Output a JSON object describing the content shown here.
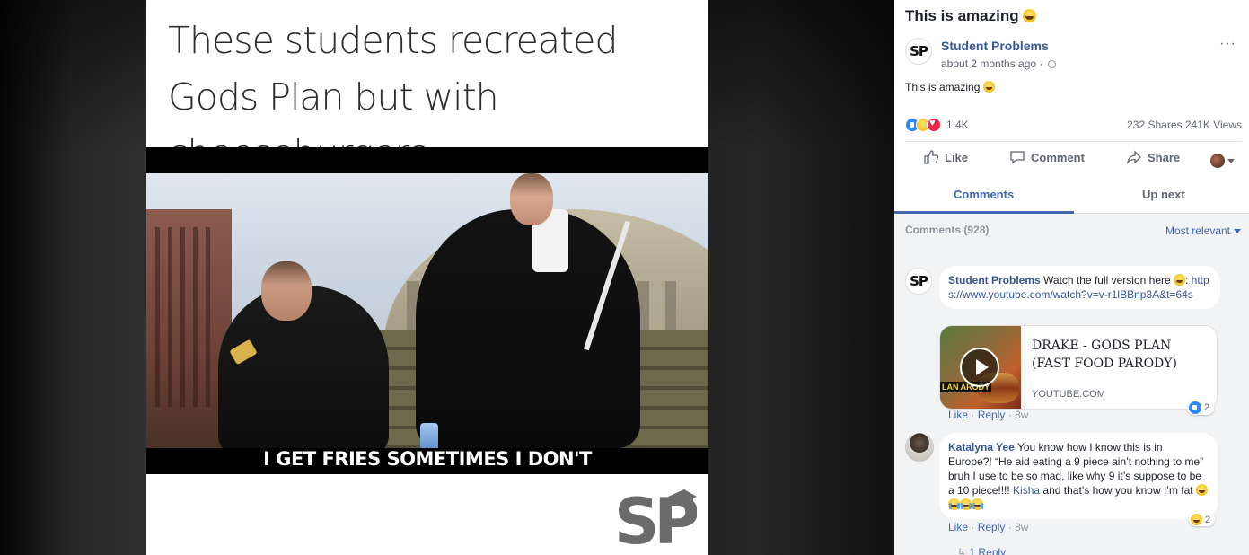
{
  "media": {
    "headline": "These students recreated Gods Plan but with cheeseburgers",
    "subtitle": "I GET FRIES SOMETIMES I DON'T",
    "watermark": "SP"
  },
  "post": {
    "title": "This is amazing",
    "page_avatar": "SP",
    "page_name": "Student Problems",
    "time": "about 2 months ago ·",
    "more": "···",
    "text": "This is amazing",
    "reaction_count": "1.4K",
    "shares": "232 Shares",
    "views": "241K Views",
    "actions": {
      "like": "Like",
      "comment": "Comment",
      "share": "Share"
    },
    "tabs": {
      "comments": "Comments",
      "up_next": "Up next"
    }
  },
  "comments_section": {
    "count_label": "Comments (928)",
    "sort_label": "Most relevant",
    "comments": [
      {
        "avatar": "SP",
        "author": "Student Problems",
        "text": "Watch the full version here",
        "link": "https://www.youtube.com/watch?v=v-r1lBBnp3A&t=64s",
        "card_title": "DRAKE - GODS PLAN (FAST FOOD PARODY)",
        "card_domain": "YOUTUBE.COM",
        "thumb_tag": "LAN ARODY",
        "like": "Like",
        "reply": "Reply",
        "age": "8w",
        "reactions": "2"
      },
      {
        "author": "Katalyna Yee",
        "text_before": "You know how I know this is in Europe?! “He aid eating a 9 piece ain’t nothing to me” bruh I use to be so mad, like why 9 it’s suppose to be a 10 piece!!!! ",
        "mention": "Kisha",
        "text_after": " and that’s how you know I’m fat",
        "like": "Like",
        "reply": "Reply",
        "age": "8w",
        "reactions": "2",
        "replies": "1 Reply"
      }
    ]
  },
  "colors": {
    "link_blue": "#365899",
    "accent_blue": "#4267b2",
    "muted": "#90949c"
  }
}
